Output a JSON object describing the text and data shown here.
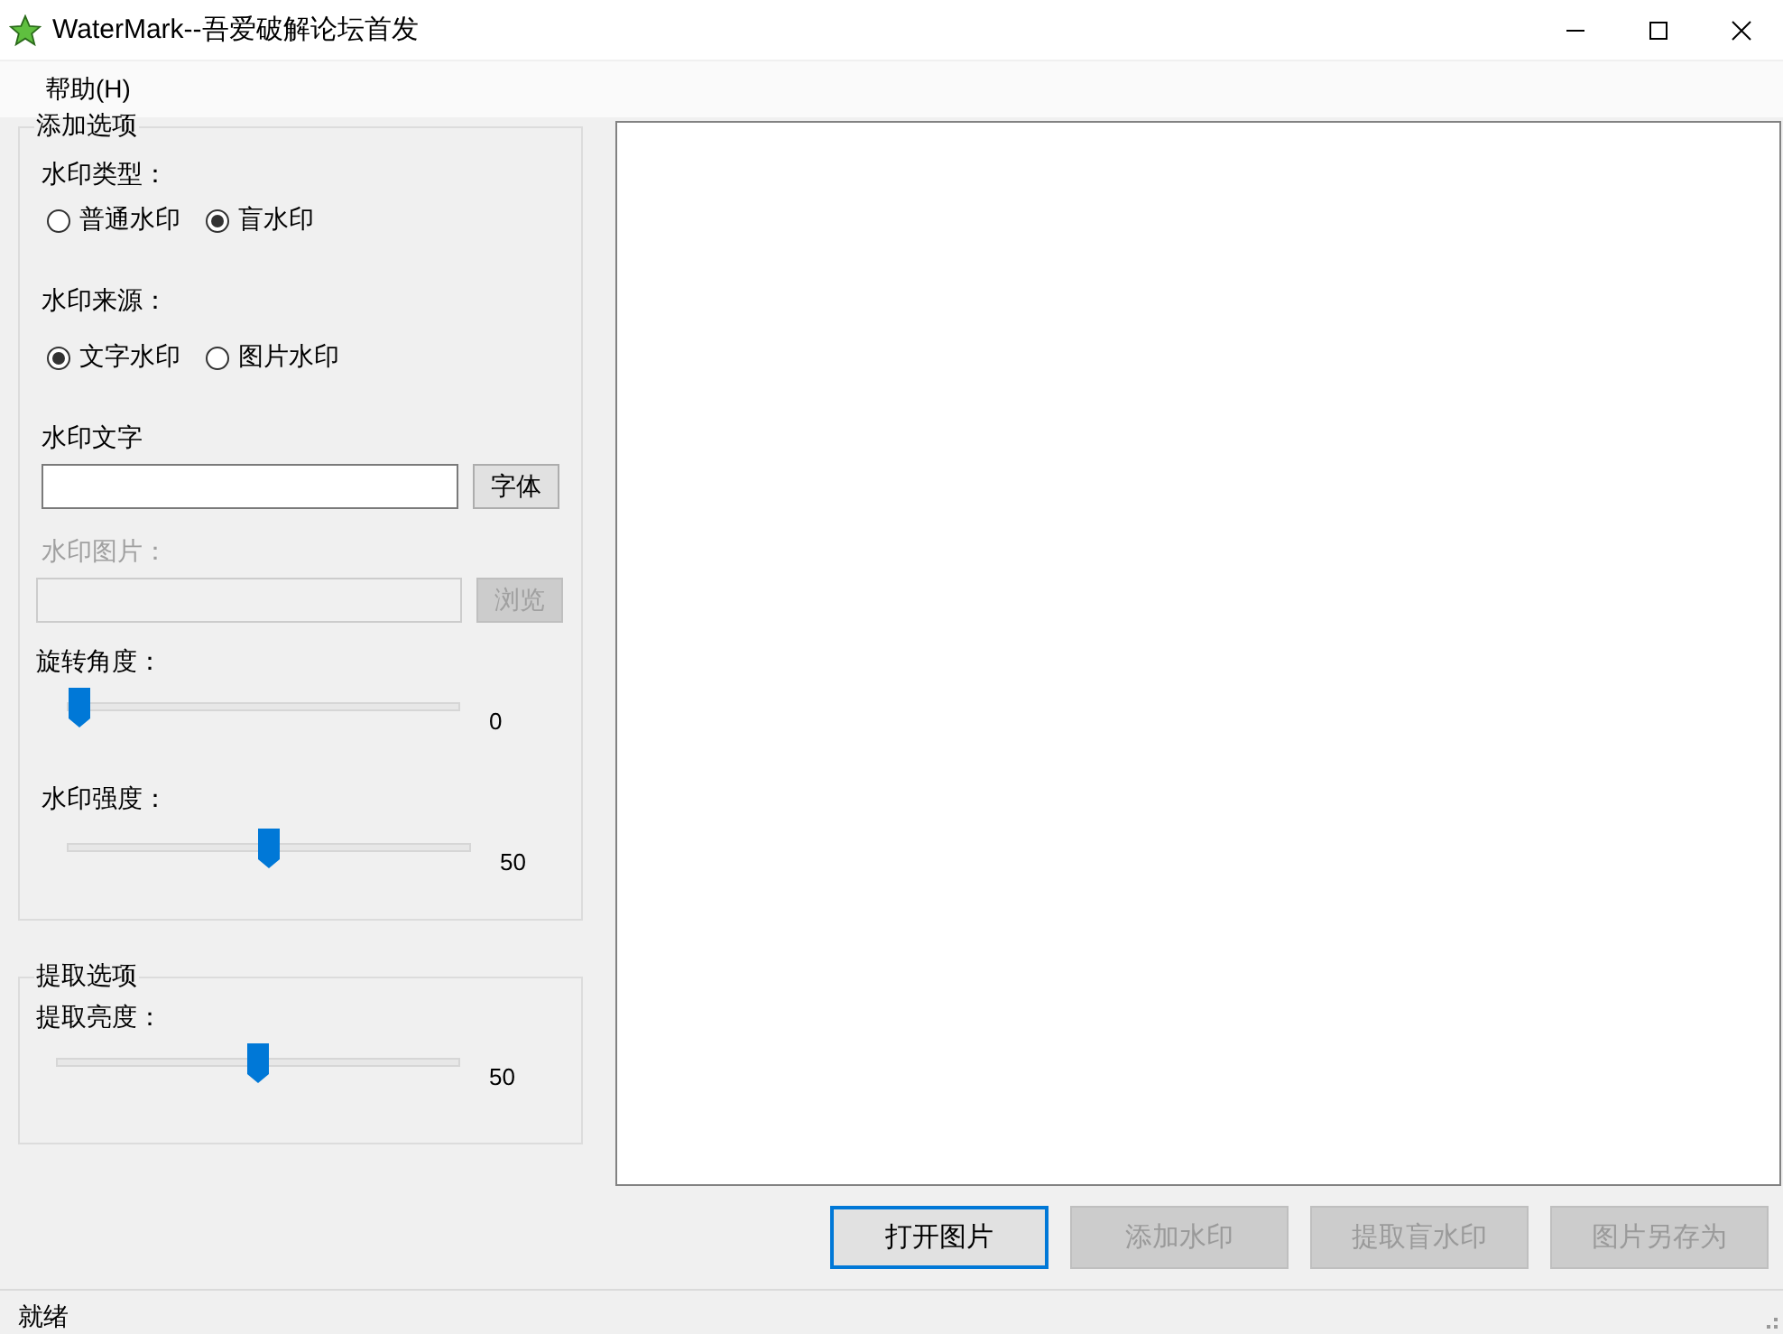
{
  "window": {
    "title": "WaterMark--吾爱破解论坛首发"
  },
  "menu": [
    {
      "label": "帮助(H)"
    }
  ],
  "add_options": {
    "title": "添加选项",
    "watermark_type": {
      "label": "水印类型：",
      "options": [
        {
          "label": "普通水印",
          "selected": false
        },
        {
          "label": "盲水印",
          "selected": true
        }
      ]
    },
    "watermark_source": {
      "label": "水印来源：",
      "options": [
        {
          "label": "文字水印",
          "selected": true
        },
        {
          "label": "图片水印",
          "selected": false
        }
      ]
    },
    "text": {
      "label": "水印文字",
      "button": "字体",
      "disabled": false
    },
    "image": {
      "label": "水印图片：",
      "button": "浏览",
      "disabled": true
    },
    "sliders": [
      {
        "label": "旋转角度：",
        "level": 0,
        "reading": "0"
      },
      {
        "label": "水印强度：",
        "level": 0.5,
        "reading": "50"
      }
    ]
  },
  "extract_options": {
    "title": "提取选项",
    "sliders": [
      {
        "label": "提取亮度：",
        "level": 0.5,
        "reading": "50"
      }
    ]
  },
  "buttons": [
    {
      "label": "打开图片",
      "disabled": false,
      "focused": true
    },
    {
      "label": "添加水印",
      "disabled": true,
      "focused": false
    },
    {
      "label": "提取盲水印",
      "disabled": true,
      "focused": false
    },
    {
      "label": "图片另存为",
      "disabled": true,
      "focused": false
    }
  ],
  "status_bar": {
    "text": "就绪"
  }
}
